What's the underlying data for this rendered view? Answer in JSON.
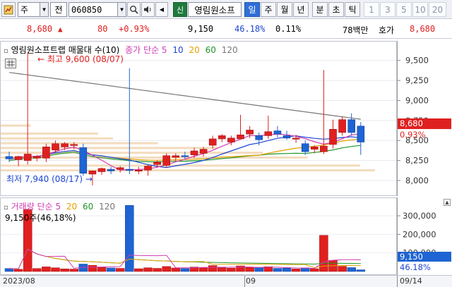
{
  "toolbar": {
    "timeframe_value": "주",
    "mode_value": "전",
    "stock_code": "060850",
    "credit_badge": "신",
    "stock_name": "영림원소프",
    "period_tabs": [
      "일",
      "주",
      "월",
      "년",
      "분",
      "초",
      "틱"
    ],
    "active_period": "일",
    "interval_buttons": [
      "1",
      "3",
      "5",
      "10",
      "20"
    ]
  },
  "quote": {
    "price": "8,680",
    "change": "80",
    "change_pct": "+0.93%",
    "volume": "9,150",
    "volume_ratio": "46.18%",
    "turnover": "0.11%",
    "amount": "78백만",
    "ask_label": "호가",
    "ask_price": "8,680"
  },
  "price_panel": {
    "legend_title": "영림원소프트랩 매물대 수(10)",
    "ma_label": "종가 단순 5",
    "ma_periods": [
      "10",
      "20",
      "60",
      "120"
    ],
    "high_annotation": "최고 9,600 (08/07)",
    "low_annotation": "최저 7,940 (08/17)",
    "current_price_tag": "8,680",
    "current_change_tag": "0.93%"
  },
  "volume_panel": {
    "legend_title": "거래량 단순 5",
    "ma_periods": [
      "20",
      "60",
      "120"
    ],
    "current_volume_label": "9,150주(46,18%)",
    "current_volume_tag": "9,150",
    "current_ratio_tag": "46.18%"
  },
  "date_axis": [
    "2023/08",
    "09",
    "09/14"
  ],
  "colors": {
    "up": "#e02020",
    "down": "#1e64d2",
    "ma5": "#d23cb4",
    "ma10": "#1e46d2",
    "ma20": "#e6a000",
    "ma60": "#1e9628",
    "ma120": "#787878",
    "volume_profile": "#f3dcc0"
  },
  "chart_data": {
    "type": "candlestick",
    "yticks_price": [
      9500,
      9250,
      9000,
      8750,
      8500,
      8250,
      8000
    ],
    "yticks_volume": [
      300000,
      200000,
      100000
    ],
    "candles": [
      {
        "o": 8300,
        "h": 8360,
        "l": 8230,
        "c": 8270
      },
      {
        "o": 8260,
        "h": 8310,
        "l": 8180,
        "c": 8300
      },
      {
        "o": 8250,
        "h": 9600,
        "l": 8200,
        "c": 8330
      },
      {
        "o": 8280,
        "h": 8320,
        "l": 8240,
        "c": 8300
      },
      {
        "o": 8280,
        "h": 8460,
        "l": 8230,
        "c": 8420
      },
      {
        "o": 8380,
        "h": 8500,
        "l": 8350,
        "c": 8460
      },
      {
        "o": 8420,
        "h": 8480,
        "l": 8380,
        "c": 8460
      },
      {
        "o": 8440,
        "h": 8480,
        "l": 8390,
        "c": 8450
      },
      {
        "o": 8410,
        "h": 8460,
        "l": 8060,
        "c": 8090
      },
      {
        "o": 8080,
        "h": 8120,
        "l": 7940,
        "c": 8120
      },
      {
        "o": 8110,
        "h": 8160,
        "l": 8070,
        "c": 8150
      },
      {
        "o": 8140,
        "h": 8170,
        "l": 8080,
        "c": 8120
      },
      {
        "o": 8140,
        "h": 8180,
        "l": 8100,
        "c": 8160
      },
      {
        "o": 8140,
        "h": 9400,
        "l": 8080,
        "c": 8130
      },
      {
        "o": 8120,
        "h": 8170,
        "l": 8080,
        "c": 8130
      },
      {
        "o": 8130,
        "h": 8200,
        "l": 8060,
        "c": 8180
      },
      {
        "o": 8200,
        "h": 8250,
        "l": 8160,
        "c": 8230
      },
      {
        "o": 8190,
        "h": 8340,
        "l": 8160,
        "c": 8310
      },
      {
        "o": 8290,
        "h": 8340,
        "l": 8240,
        "c": 8310
      },
      {
        "o": 8310,
        "h": 8360,
        "l": 8270,
        "c": 8300
      },
      {
        "o": 8320,
        "h": 8410,
        "l": 8280,
        "c": 8370
      },
      {
        "o": 8340,
        "h": 8420,
        "l": 8300,
        "c": 8390
      },
      {
        "o": 8440,
        "h": 8560,
        "l": 8400,
        "c": 8520
      },
      {
        "o": 8520,
        "h": 8580,
        "l": 8480,
        "c": 8560
      },
      {
        "o": 8480,
        "h": 8560,
        "l": 8440,
        "c": 8530
      },
      {
        "o": 8520,
        "h": 8820,
        "l": 8520,
        "c": 8570
      },
      {
        "o": 8580,
        "h": 8680,
        "l": 8530,
        "c": 8630
      },
      {
        "o": 8560,
        "h": 8600,
        "l": 8440,
        "c": 8510
      },
      {
        "o": 8560,
        "h": 8810,
        "l": 8520,
        "c": 8610
      },
      {
        "o": 8620,
        "h": 8680,
        "l": 8540,
        "c": 8580
      },
      {
        "o": 8560,
        "h": 8620,
        "l": 8510,
        "c": 8530
      },
      {
        "o": 8520,
        "h": 8570,
        "l": 8470,
        "c": 8530
      },
      {
        "o": 8460,
        "h": 8500,
        "l": 8320,
        "c": 8360
      },
      {
        "o": 8390,
        "h": 8440,
        "l": 8340,
        "c": 8420
      },
      {
        "o": 8360,
        "h": 9380,
        "l": 8330,
        "c": 8430
      },
      {
        "o": 8450,
        "h": 8760,
        "l": 8400,
        "c": 8640
      },
      {
        "o": 8600,
        "h": 8800,
        "l": 8560,
        "c": 8760
      },
      {
        "o": 8760,
        "h": 8840,
        "l": 8560,
        "c": 8600
      },
      {
        "o": 8680,
        "h": 8730,
        "l": 8320,
        "c": 8480
      }
    ],
    "volumes": [
      16000,
      12000,
      335000,
      16000,
      25000,
      20000,
      14000,
      13000,
      40000,
      33000,
      22000,
      19000,
      17000,
      356000,
      15000,
      20000,
      17000,
      27000,
      19000,
      16000,
      24000,
      22000,
      32000,
      20000,
      18000,
      30000,
      22000,
      21000,
      26000,
      17000,
      18000,
      14000,
      20000,
      15000,
      195000,
      60000,
      28000,
      21000,
      9150
    ],
    "volume_profile": [
      {
        "lo": 8650,
        "hi": 8700,
        "vol": 8
      },
      {
        "lo": 8550,
        "hi": 8600,
        "vol": 26
      },
      {
        "lo": 8490,
        "hi": 8540,
        "vol": 30
      },
      {
        "lo": 8430,
        "hi": 8480,
        "vol": 42
      },
      {
        "lo": 8370,
        "hi": 8420,
        "vol": 58
      },
      {
        "lo": 8310,
        "hi": 8360,
        "vol": 70
      },
      {
        "lo": 8260,
        "hi": 8300,
        "vol": 82
      },
      {
        "lo": 8150,
        "hi": 8200,
        "vol": 96
      },
      {
        "lo": 8100,
        "hi": 8140,
        "vol": 100
      }
    ]
  }
}
